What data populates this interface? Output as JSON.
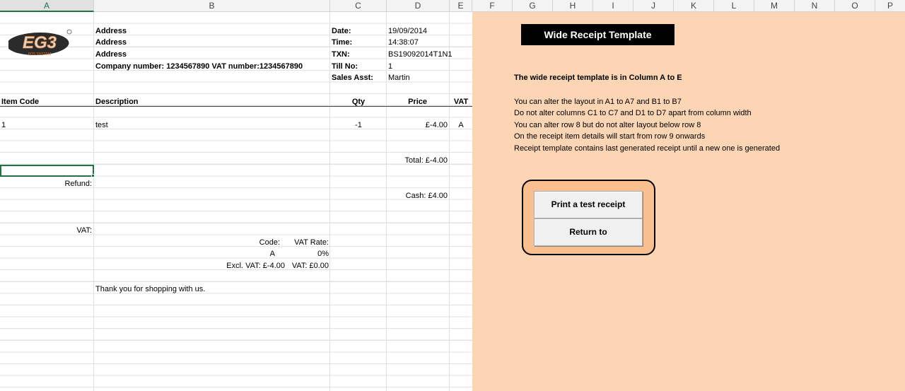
{
  "columns": [
    "A",
    "B",
    "C",
    "D",
    "E",
    "F",
    "G",
    "H",
    "I",
    "J",
    "K",
    "L",
    "M",
    "N",
    "O",
    "P"
  ],
  "active_column": "A",
  "logo": {
    "text": "EG3",
    "subtext": "POS SYSTEM"
  },
  "header": {
    "address_1": "Address",
    "address_2": "Address",
    "address_3": "Address",
    "company_line": "Company number: 1234567890  VAT number:1234567890",
    "date_label": "Date:",
    "date_value": "19/09/2014",
    "time_label": "Time:",
    "time_value": "14:38:07",
    "txn_label": "TXN:",
    "txn_value": "BS19092014T1N1",
    "till_label": "Till No:",
    "till_value": "1",
    "asst_label": "Sales Asst:",
    "asst_value": "Martin"
  },
  "table": {
    "headers": {
      "item_code": "Item Code",
      "description": "Description",
      "qty": "Qty",
      "price": "Price",
      "vat": "VAT"
    },
    "rows": [
      {
        "item_code": "1",
        "description": "test",
        "qty": "-1",
        "price": "£-4.00",
        "vat": "A"
      }
    ]
  },
  "totals": {
    "total": "Total: £-4.00",
    "refund_label": "Refund:",
    "cash": "Cash: £4.00",
    "vat_label": "VAT:",
    "code_label": "Code:",
    "vat_rate_label": "VAT Rate:",
    "code_value": "A",
    "rate_value": "0%",
    "excl_vat": "Excl. VAT: £-4.00",
    "vat_amount": "VAT: £0.00"
  },
  "footer": {
    "thanks": "Thank you for shopping with us."
  },
  "panel": {
    "title": "Wide Receipt Template",
    "intro": "The wide receipt template is in Column A to E",
    "notes": [
      "You can alter the layout in A1 to A7 and B1 to B7",
      "Do not alter columns C1 to C7 and D1 to D7 apart from column width",
      "You can alter row 8 but do not alter layout below row 8",
      "On the receipt item details will start from row 9 onwards",
      "Receipt template contains last generated receipt until a new one is generated"
    ],
    "print_button": "Print a test receipt",
    "return_button": "Return to"
  },
  "colors": {
    "panel": "#fcd5b4",
    "button_frame": "#fabf8f",
    "selection": "#217346"
  }
}
